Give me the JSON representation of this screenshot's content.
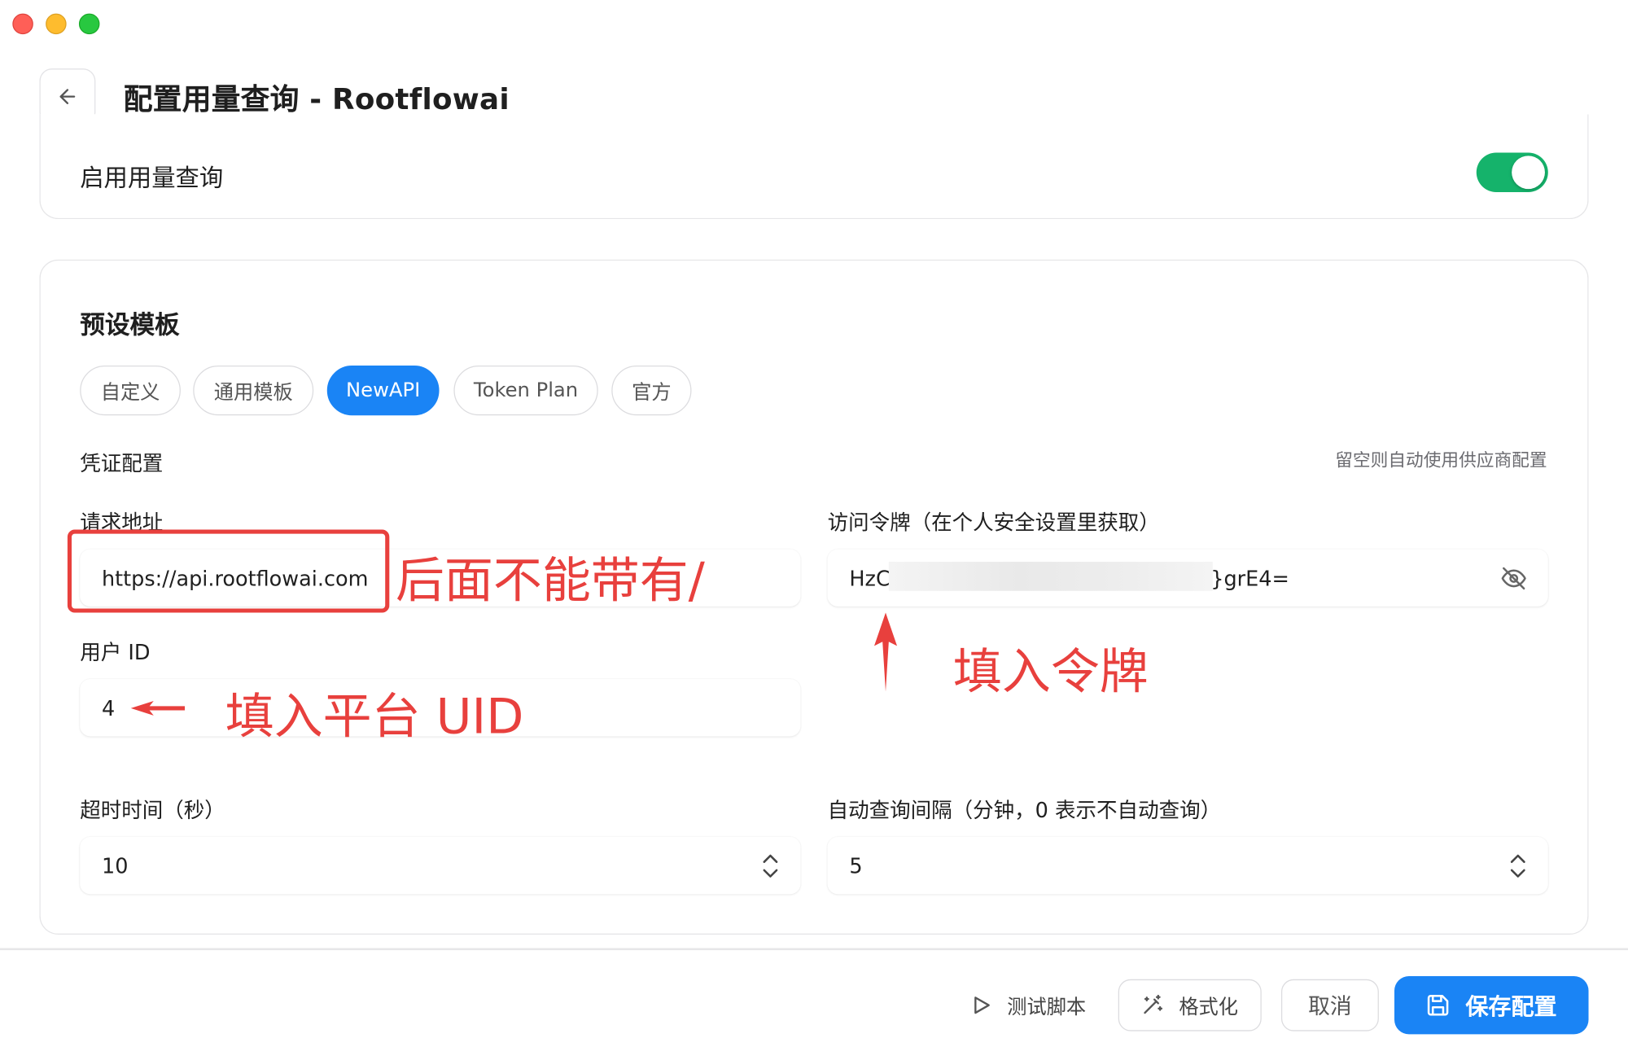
{
  "header": {
    "title": "配置用量查询 - Rootflowai"
  },
  "enable_card": {
    "label": "启用用量查询",
    "enabled": true,
    "accent_color": "#15b36b"
  },
  "presets": {
    "title": "预设模板",
    "items": [
      {
        "label": "自定义",
        "active": false
      },
      {
        "label": "通用模板",
        "active": false
      },
      {
        "label": "NewAPI",
        "active": true
      },
      {
        "label": "Token Plan",
        "active": false
      },
      {
        "label": "官方",
        "active": false
      }
    ]
  },
  "credentials": {
    "title": "凭证配置",
    "hint": "留空则自动使用供应商配置",
    "request_url": {
      "label": "请求地址",
      "value": "https://api.rootflowai.com"
    },
    "access_token": {
      "label": "访问令牌（在个人安全设置里获取）",
      "value_prefix": "HzC",
      "value_suffix": "}grE4="
    },
    "user_id": {
      "label": "用户 ID",
      "value": "4"
    },
    "timeout": {
      "label": "超时时间（秒）",
      "value": "10"
    },
    "auto_interval": {
      "label": "自动查询间隔（分钟，0 表示不自动查询）",
      "value": "5"
    }
  },
  "annotations": {
    "url_note": "后面不能带有/",
    "token_note": "填入令牌",
    "uid_note": "填入平台 UID",
    "color": "#e8403d"
  },
  "footer": {
    "test_label": "测试脚本",
    "format_label": "格式化",
    "cancel_label": "取消",
    "save_label": "保存配置",
    "primary_color": "#1a84f5"
  }
}
